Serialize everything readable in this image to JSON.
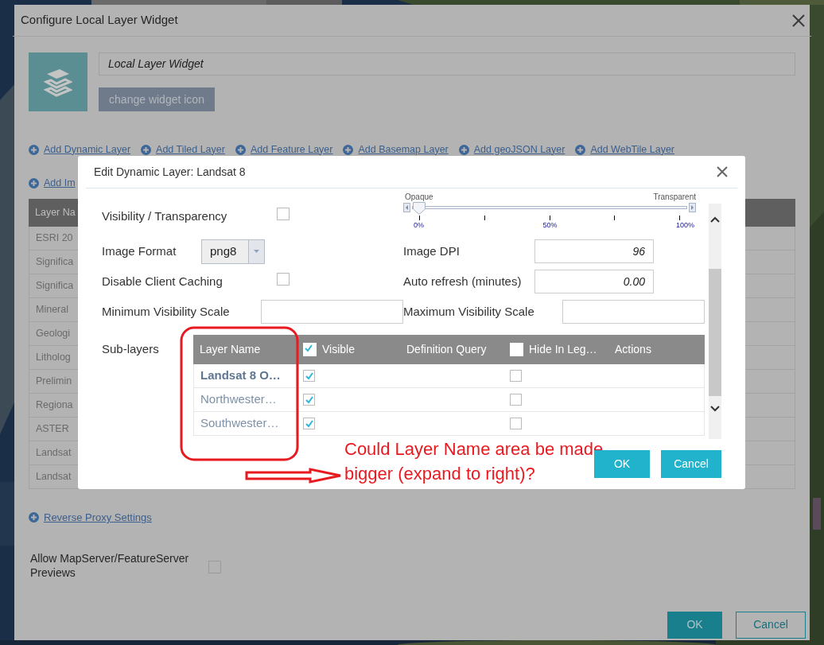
{
  "window": {
    "title": "Configure Local Layer Widget"
  },
  "widget_name": {
    "value": "Local Layer Widget"
  },
  "change_icon_button": "change widget icon",
  "add_links": [
    {
      "label": "Add Dynamic Layer"
    },
    {
      "label": "Add Tiled Layer"
    },
    {
      "label": "Add Feature Layer"
    },
    {
      "label": "Add Basemap Layer"
    },
    {
      "label": "Add geoJSON Layer"
    },
    {
      "label": "Add WebTile Layer"
    },
    {
      "label": "Add Im"
    }
  ],
  "layers_table": {
    "columns": [
      "Layer Na"
    ],
    "rows": [
      "ESRI 20",
      "Significa",
      "Significa",
      "Mineral",
      "Geologi",
      "Litholog",
      "Prelimin",
      "Regiona",
      "ASTER",
      "Landsat",
      "Landsat"
    ]
  },
  "reverse_proxy_link": "Reverse Proxy Settings",
  "allow_previews": {
    "label": "Allow MapServer/FeatureServer Previews",
    "checked": false
  },
  "buttons": [
    "OK",
    "Cancel"
  ],
  "edit_dialog": {
    "title": "Edit Dynamic Layer: Landsat 8",
    "visibility": {
      "label": "Visibility / Transparency",
      "checked": false
    },
    "transparency_slider": {
      "min_label": "Opaque",
      "max_label": "Transparent",
      "level": 0,
      "tick_labels": [
        "0%",
        "50%",
        "100%"
      ]
    },
    "image_format": {
      "label": "Image Format",
      "value": "png8"
    },
    "image_dpi": {
      "label": "Image DPI",
      "value": "96"
    },
    "disable_caching": {
      "label": "Disable Client Caching",
      "checked": false
    },
    "auto_refresh": {
      "label": "Auto refresh (minutes)",
      "value": "0.00"
    },
    "min_scale": {
      "label": "Minimum Visibility Scale"
    },
    "max_scale": {
      "label": "Maximum Visibility Scale"
    },
    "sublayers": {
      "label": "Sub-layers",
      "columns": [
        {
          "label": "Layer Name"
        },
        {
          "label": "Visible",
          "checked": true
        },
        {
          "label": "Definition Query"
        },
        {
          "label": "Hide In Leg…",
          "checked": false
        },
        {
          "label": "Actions"
        }
      ],
      "rows": [
        {
          "name": "Landsat 8 O…",
          "bold": true,
          "visible": true,
          "hide_in_legend": false
        },
        {
          "name": "Northwester…",
          "bold": false,
          "visible": true,
          "hide_in_legend": false
        },
        {
          "name": "Southwester…",
          "bold": false,
          "visible": true,
          "hide_in_legend": false
        }
      ]
    },
    "buttons": [
      "OK",
      "Cancel"
    ]
  },
  "annotation": {
    "lines": [
      "Could Layer Name area be made",
      "bigger (expand to right)?"
    ]
  }
}
